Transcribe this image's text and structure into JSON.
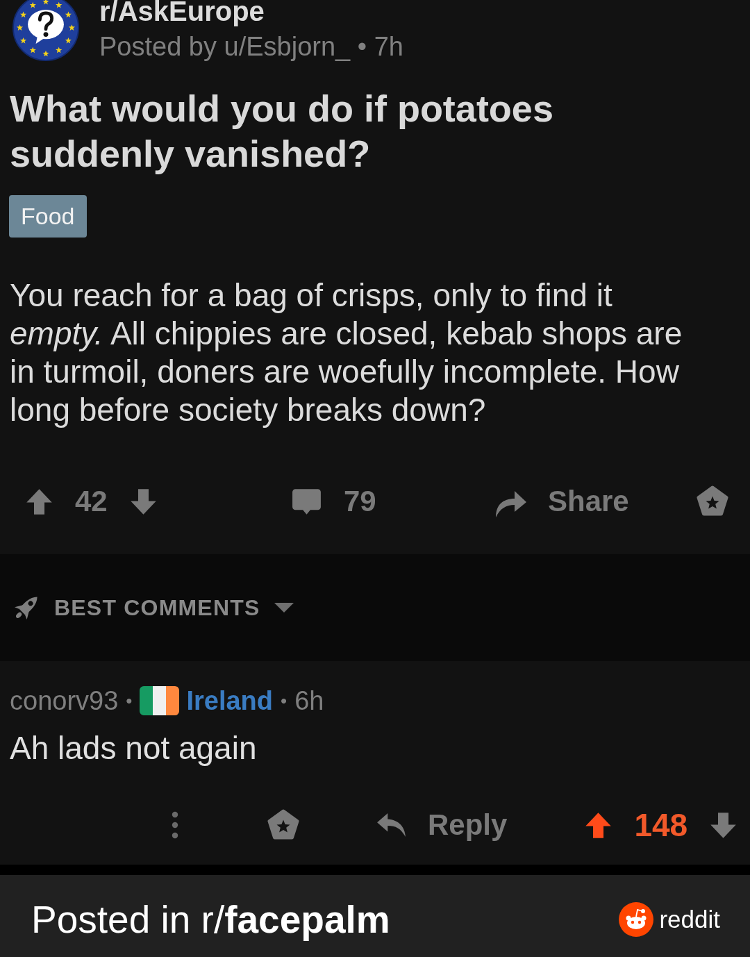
{
  "post": {
    "subreddit": "r/AskEurope",
    "byline": "Posted by u/Esbjorn_ • 7h",
    "title": "What would you do if potatoes suddenly vanished?",
    "flair": "Food",
    "body": "You reach for a bag of crisps, only to find it *empty.* All chippies are closed, kebab shops are in turmoil, doners are woefully incomplete. How long before society breaks down?",
    "upvoted": false,
    "downvoted": false,
    "score": "42",
    "comment_count": "79",
    "share_label": "Share"
  },
  "sort_bar": {
    "label": "BEST COMMENTS"
  },
  "comments": [
    {
      "meta": [
        {
          "kind": "author",
          "text": "conorv93"
        },
        {
          "kind": "separator",
          "text": "•"
        },
        {
          "kind": "flair",
          "text": "Ireland"
        },
        {
          "kind": "separator",
          "text": "•"
        },
        {
          "kind": "time",
          "text": "6h"
        }
      ],
      "body": "Ah lads not again",
      "reply_label": "Reply",
      "upvoted": true,
      "downvoted": false,
      "score": "148"
    }
  ],
  "banner": {
    "text": "Posted in r/**facepalm**",
    "brand": "reddit"
  }
}
